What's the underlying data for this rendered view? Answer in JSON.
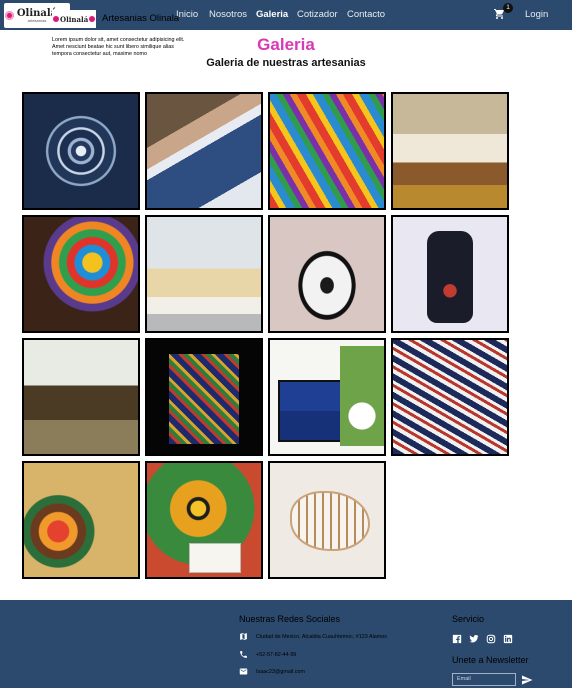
{
  "navbar": {
    "logo_title": "Olinalá",
    "logo_sub": "artesanías",
    "links": [
      "Inicio",
      "Nosotros",
      "Galeria",
      "Cotizador",
      "Contacto"
    ],
    "active": "Galeria",
    "cart_count": "1",
    "login": "Login"
  },
  "page": {
    "title": "Galeria",
    "subtitle": "Galeria de nuestras artesanias"
  },
  "gallery": {
    "items": [
      "lacquered blue mandala tray",
      "artisan painting blue tray",
      "colorful huichol beadwork",
      "artisan painting lacquer boxes",
      "huichol beaded jaguar head",
      "painted bedroom furniture",
      "lacquered tray with flower motif",
      "lacquered floral bottle",
      "lacquered chests on display",
      "painting a dark lacquer panel",
      "blue lacquered box with flowers",
      "patterned lacquered boxes",
      "market craft figures",
      "jaguar mask and boxes",
      "white lacquered fish"
    ]
  },
  "footer": {
    "logo_title": "Olinalá",
    "brand": "Artesanias Olinala",
    "description": "Lorem ipsum dolor sit, amet consectetur adipisicing elit. Amet nesciunt beatae hic sunt libero similique alias tempora consectetur aut, maxime nomo",
    "social_title": "Nuestras Redes Sociales",
    "address": "Ciudad de Mexico, Alcaldia Cuauhtemoc, #123 Alamos",
    "phone": "+52-57-82-44-99",
    "email": "Isaac23@gmail.com",
    "service_title": "Servicio",
    "newsletter_title": "Unete a Newsletter",
    "email_placeholder": "Email"
  },
  "colors": {
    "navbar_bg": "#2b4a6e",
    "title_accent": "#d63ab5"
  }
}
